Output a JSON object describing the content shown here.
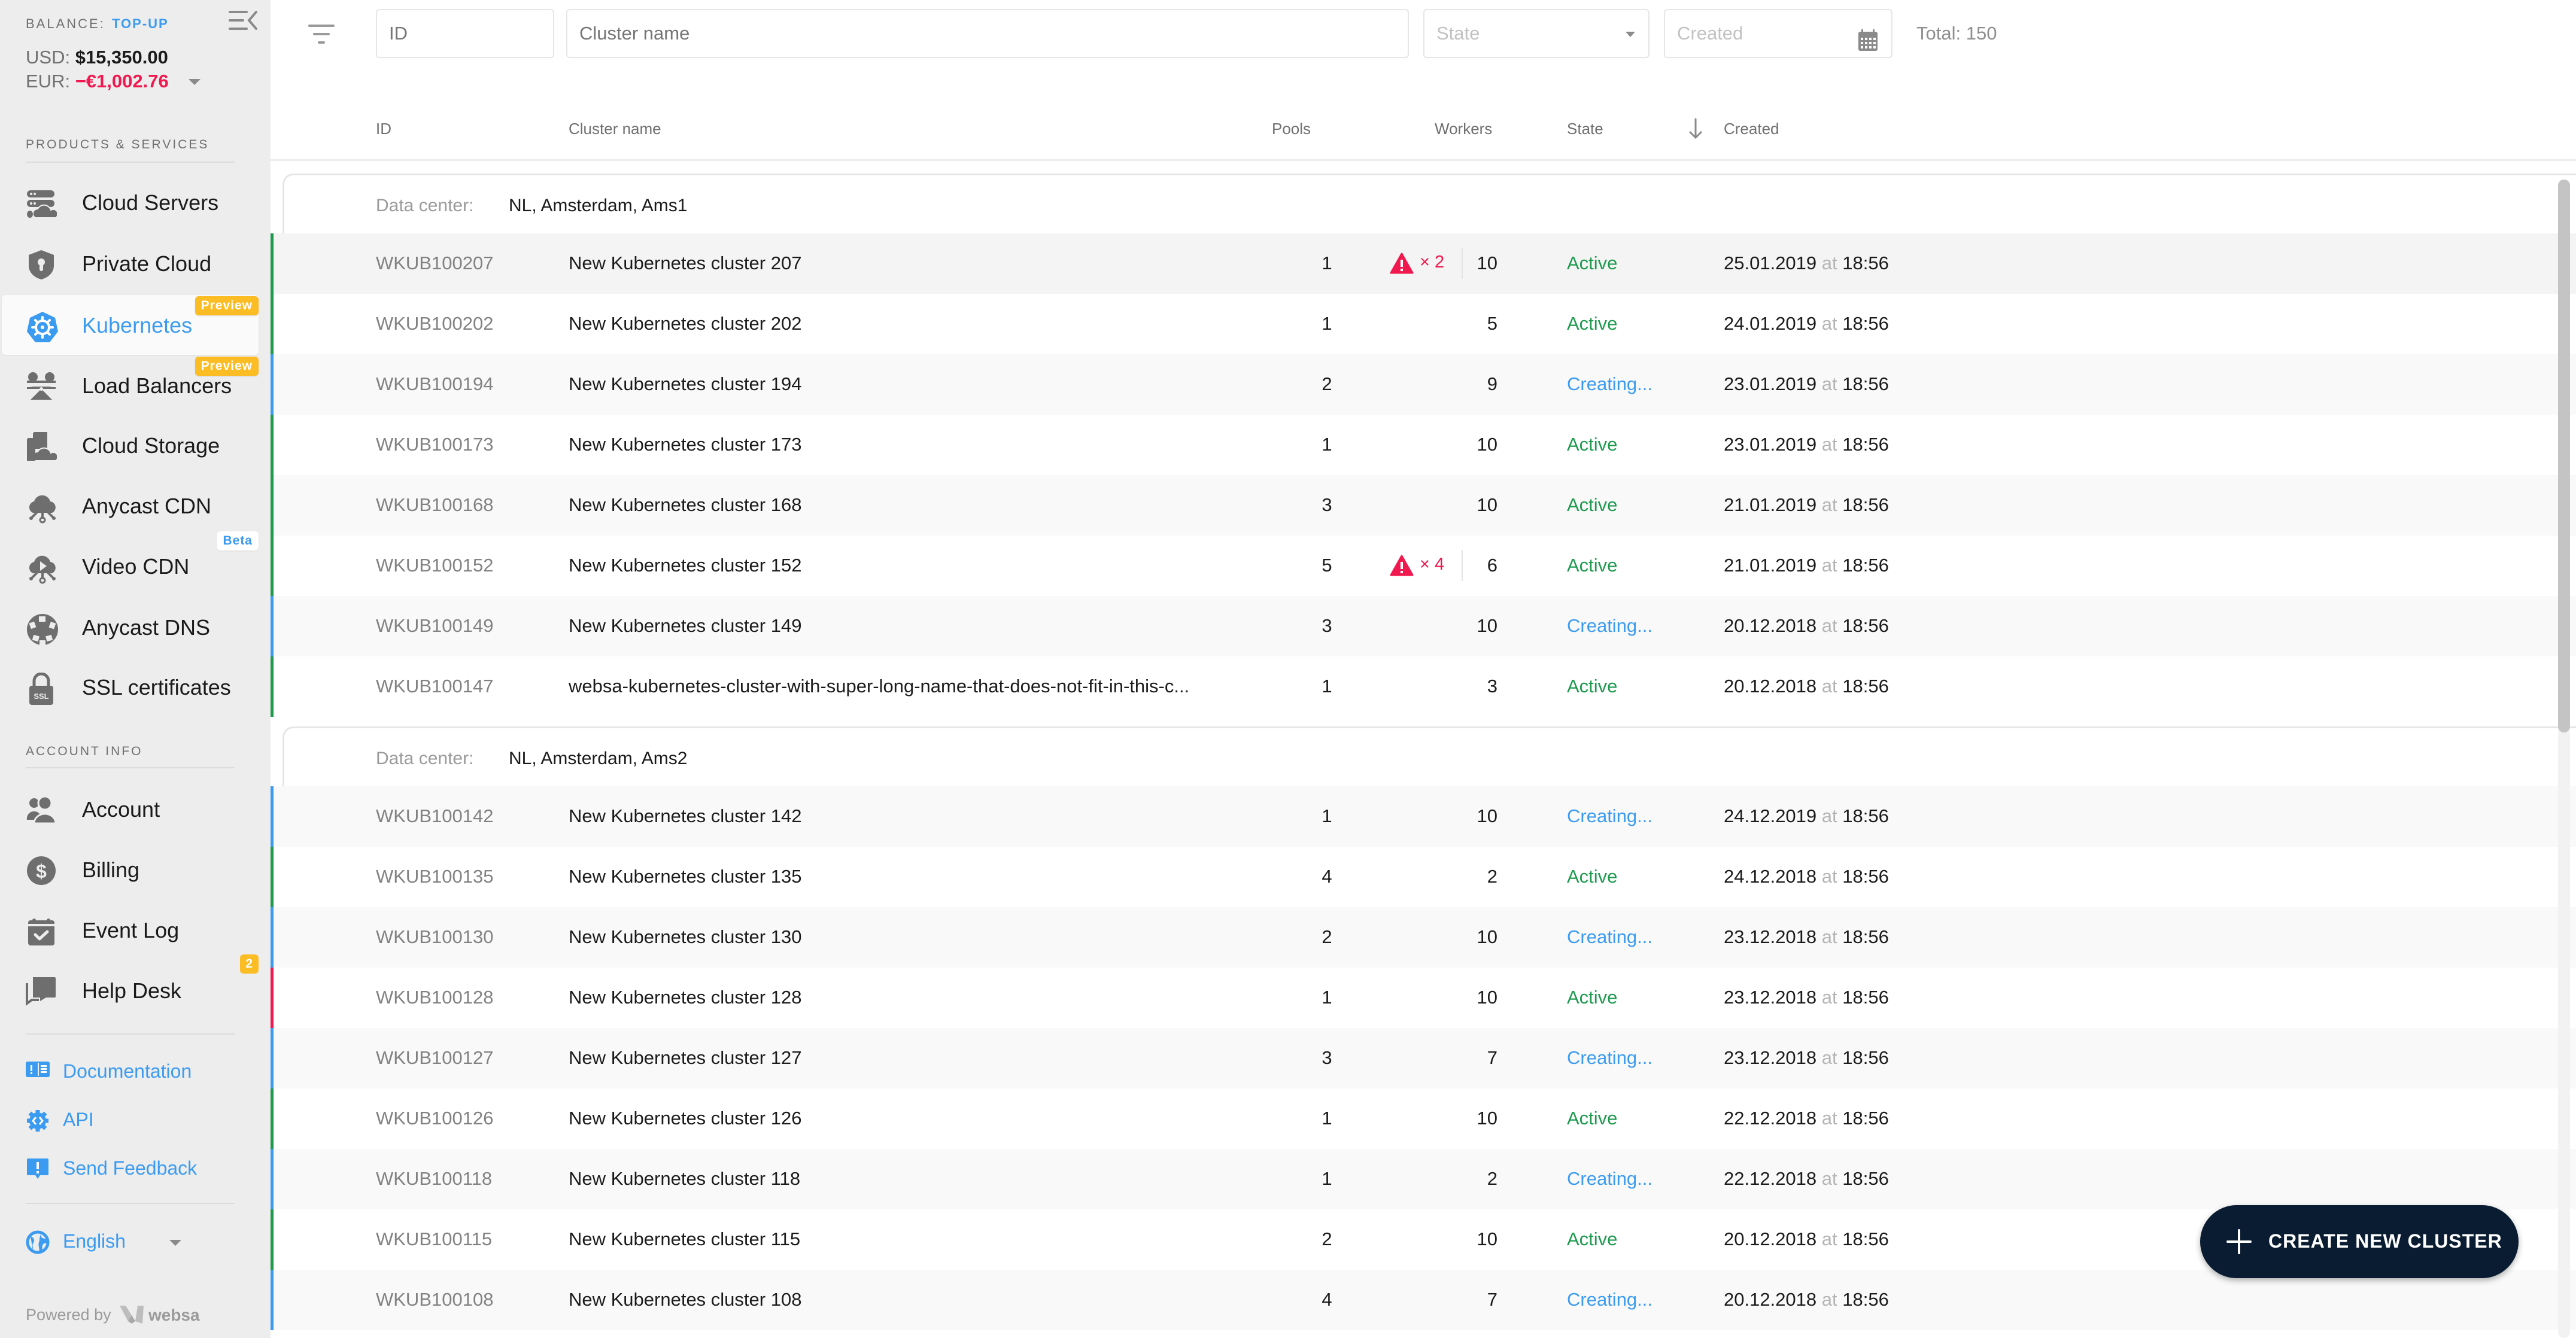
{
  "sidebar": {
    "balance_label": "BALANCE:",
    "topup_label": "TOP-UP",
    "usd_label": "USD:",
    "usd_value": "$15,350.00",
    "eur_label": "EUR:",
    "eur_value": "−€1,002.76",
    "products_section": "PRODUCTS & SERVICES",
    "products": [
      {
        "label": "Cloud Servers",
        "icon": "cloud-servers-icon"
      },
      {
        "label": "Private Cloud",
        "icon": "shield-lock-icon"
      },
      {
        "label": "Kubernetes",
        "icon": "kubernetes-icon",
        "badge": "Preview",
        "active": true
      },
      {
        "label": "Load Balancers",
        "icon": "load-balancer-icon",
        "badge": "Preview"
      },
      {
        "label": "Cloud Storage",
        "icon": "cloud-storage-icon"
      },
      {
        "label": "Anycast CDN",
        "icon": "cdn-cloud-icon"
      },
      {
        "label": "Video CDN",
        "icon": "video-cdn-icon",
        "badge": "Beta"
      },
      {
        "label": "Anycast DNS",
        "icon": "dns-icon"
      },
      {
        "label": "SSL certificates",
        "icon": "ssl-lock-icon"
      }
    ],
    "account_section": "ACCOUNT INFO",
    "account": [
      {
        "label": "Account",
        "icon": "users-icon"
      },
      {
        "label": "Billing",
        "icon": "dollar-circle-icon"
      },
      {
        "label": "Event Log",
        "icon": "calendar-check-icon"
      },
      {
        "label": "Help Desk",
        "icon": "chat-icon",
        "badge": "2"
      }
    ],
    "links": [
      {
        "label": "Documentation",
        "icon": "book-icon"
      },
      {
        "label": "API",
        "icon": "api-gear-icon"
      },
      {
        "label": "Send Feedback",
        "icon": "feedback-icon"
      }
    ],
    "language": "English",
    "powered_by": "Powered by",
    "brand": "websa"
  },
  "filters": {
    "id_placeholder": "ID",
    "name_placeholder": "Cluster name",
    "state_placeholder": "State",
    "created_placeholder": "Created",
    "total": "Total: 150"
  },
  "columns": {
    "id": "ID",
    "name": "Cluster name",
    "pools": "Pools",
    "workers": "Workers",
    "state": "State",
    "created": "Created"
  },
  "colors": {
    "active": "#1d9a4e",
    "creating": "#3b9bf0",
    "error": "#f0184e",
    "accent": "#3b9bf0"
  },
  "groups": [
    {
      "label": "Data center:",
      "value": "NL, Amsterdam, Ams1",
      "rows": [
        {
          "id": "WKUB100207",
          "name": "New Kubernetes cluster 207",
          "pools": "1",
          "warnings": "× 2",
          "workers": "10",
          "state": "Active",
          "date": "25.01.2019",
          "at": "at",
          "time": "18:56",
          "stripe": "active"
        },
        {
          "id": "WKUB100202",
          "name": "New Kubernetes cluster 202",
          "pools": "1",
          "workers": "5",
          "state": "Active",
          "date": "24.01.2019",
          "at": "at",
          "time": "18:56",
          "stripe": "active"
        },
        {
          "id": "WKUB100194",
          "name": "New Kubernetes cluster 194",
          "pools": "2",
          "workers": "9",
          "state": "Creating...",
          "date": "23.01.2019",
          "at": "at",
          "time": "18:56",
          "stripe": "creating"
        },
        {
          "id": "WKUB100173",
          "name": "New Kubernetes cluster 173",
          "pools": "1",
          "workers": "10",
          "state": "Active",
          "date": "23.01.2019",
          "at": "at",
          "time": "18:56",
          "stripe": "active"
        },
        {
          "id": "WKUB100168",
          "name": "New Kubernetes cluster 168",
          "pools": "3",
          "workers": "10",
          "state": "Active",
          "date": "21.01.2019",
          "at": "at",
          "time": "18:56",
          "stripe": "active"
        },
        {
          "id": "WKUB100152",
          "name": "New Kubernetes cluster 152",
          "pools": "5",
          "warnings": "× 4",
          "workers": "6",
          "state": "Active",
          "date": "21.01.2019",
          "at": "at",
          "time": "18:56",
          "stripe": "active"
        },
        {
          "id": "WKUB100149",
          "name": "New Kubernetes cluster 149",
          "pools": "3",
          "workers": "10",
          "state": "Creating...",
          "date": "20.12.2018",
          "at": "at",
          "time": "18:56",
          "stripe": "creating"
        },
        {
          "id": "WKUB100147",
          "name": "websa-kubernetes-cluster-with-super-long-name-that-does-not-fit-in-this-c...",
          "pools": "1",
          "workers": "3",
          "state": "Active",
          "date": "20.12.2018",
          "at": "at",
          "time": "18:56",
          "stripe": "active"
        }
      ]
    },
    {
      "label": "Data center:",
      "value": "NL, Amsterdam, Ams2",
      "rows": [
        {
          "id": "WKUB100142",
          "name": "New Kubernetes cluster 142",
          "pools": "1",
          "workers": "10",
          "state": "Creating...",
          "date": "24.12.2019",
          "at": "at",
          "time": "18:56",
          "stripe": "creating"
        },
        {
          "id": "WKUB100135",
          "name": "New Kubernetes cluster 135",
          "pools": "4",
          "workers": "2",
          "state": "Active",
          "date": "24.12.2018",
          "at": "at",
          "time": "18:56",
          "stripe": "active"
        },
        {
          "id": "WKUB100130",
          "name": "New Kubernetes cluster 130",
          "pools": "2",
          "workers": "10",
          "state": "Creating...",
          "date": "23.12.2018",
          "at": "at",
          "time": "18:56",
          "stripe": "creating"
        },
        {
          "id": "WKUB100128",
          "name": "New Kubernetes cluster 128",
          "pools": "1",
          "workers": "10",
          "state": "Active",
          "date": "23.12.2018",
          "at": "at",
          "time": "18:56",
          "stripe": "error"
        },
        {
          "id": "WKUB100127",
          "name": "New Kubernetes cluster 127",
          "pools": "3",
          "workers": "7",
          "state": "Creating...",
          "date": "23.12.2018",
          "at": "at",
          "time": "18:56",
          "stripe": "creating"
        },
        {
          "id": "WKUB100126",
          "name": "New Kubernetes cluster 126",
          "pools": "1",
          "workers": "10",
          "state": "Active",
          "date": "22.12.2018",
          "at": "at",
          "time": "18:56",
          "stripe": "active"
        },
        {
          "id": "WKUB100118",
          "name": "New Kubernetes cluster 118",
          "pools": "1",
          "workers": "2",
          "state": "Creating...",
          "date": "22.12.2018",
          "at": "at",
          "time": "18:56",
          "stripe": "creating"
        },
        {
          "id": "WKUB100115",
          "name": "New Kubernetes cluster 115",
          "pools": "2",
          "workers": "10",
          "state": "Active",
          "date": "20.12.2018",
          "at": "at",
          "time": "18:56",
          "stripe": "active"
        },
        {
          "id": "WKUB100108",
          "name": "New Kubernetes cluster 108",
          "pools": "4",
          "workers": "7",
          "state": "Creating...",
          "date": "20.12.2018",
          "at": "at",
          "time": "18:56",
          "stripe": "creating"
        }
      ]
    }
  ],
  "fab": {
    "label": "CREATE NEW CLUSTER"
  }
}
